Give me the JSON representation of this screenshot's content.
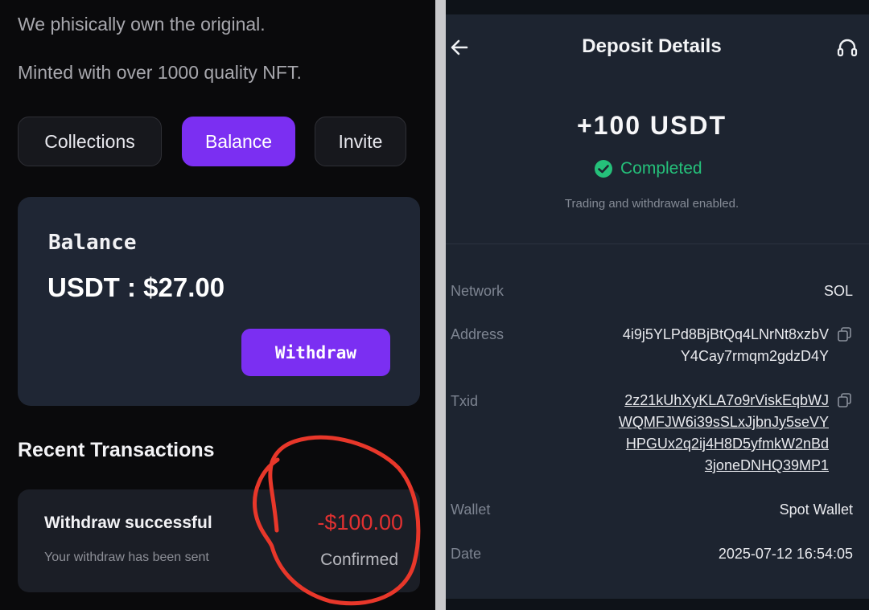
{
  "left": {
    "intro_line1": "We phisically own the original.",
    "intro_line2": "Minted with over 1000 quality NFT.",
    "tabs": [
      {
        "label": "Collections"
      },
      {
        "label": "Balance"
      },
      {
        "label": "Invite"
      }
    ],
    "active_tab": "Balance",
    "balance": {
      "title": "Balance",
      "amount": "USDT : $27.00",
      "withdraw_label": "Withdraw"
    },
    "recent_title": "Recent Transactions",
    "transaction": {
      "title": "Withdraw successful",
      "subtitle": "Your withdraw has been sent",
      "amount": "-$100.00",
      "status": "Confirmed"
    }
  },
  "right": {
    "title": "Deposit Details",
    "amount": "+100 USDT",
    "status": "Completed",
    "note": "Trading and withdrawal enabled.",
    "details": {
      "network_label": "Network",
      "network_value": "SOL",
      "address_label": "Address",
      "address_lines": [
        "4i9j5YLPd8BjBtQq4LNrNt8xzbV",
        "Y4Cay7rmqm2gdzD4Y"
      ],
      "txid_label": "Txid",
      "txid_lines": [
        "2z21kUhXyKLA7o9rViskEqbWJ",
        "WQMFJW6i39sSLxJjbnJy5seVY",
        "HPGUx2q2ij4H8D5yfmkW2nBd",
        "3joneDNHQ39MP1"
      ],
      "wallet_label": "Wallet",
      "wallet_value": "Spot Wallet",
      "date_label": "Date",
      "date_value": "2025-07-12 16:54:05"
    }
  },
  "icons": {
    "back": "arrow-left-icon",
    "support": "headset-icon",
    "status": "check-circle-icon",
    "copy": "copy-icon"
  },
  "colors": {
    "accent": "#7b2ff2",
    "success": "#25c07a",
    "negative": "#e03131",
    "annotation": "#e8372a"
  }
}
